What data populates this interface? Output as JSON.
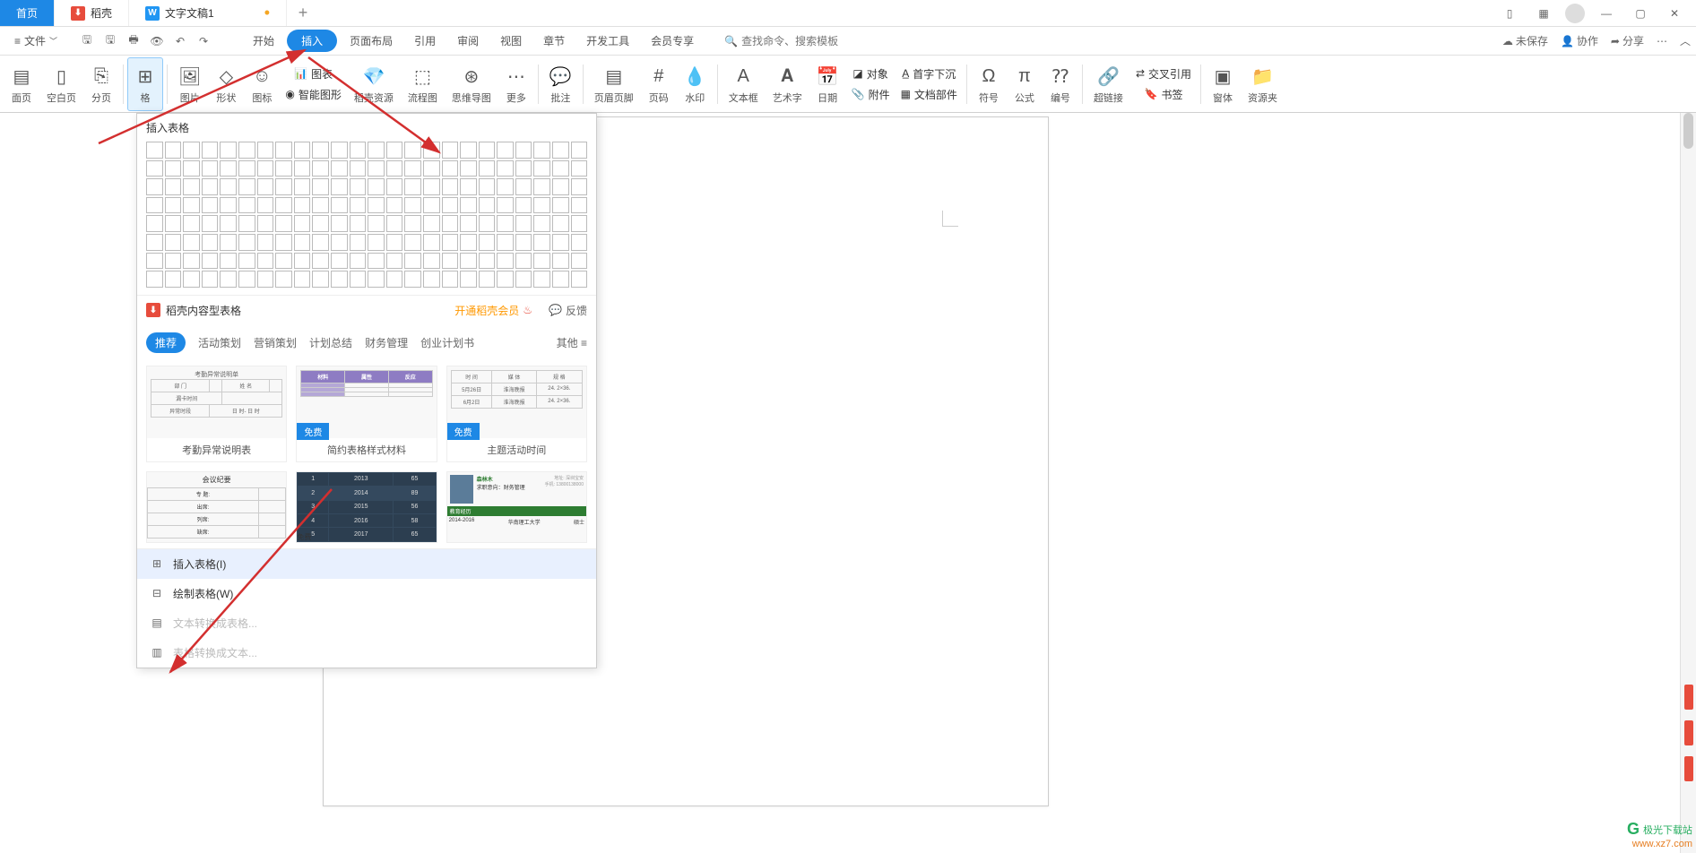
{
  "titlebar": {
    "home": "首页",
    "docer": "稻壳",
    "doc_title": "文字文稿1",
    "newtab_glyph": "+"
  },
  "menubar": {
    "file": "文件",
    "tabs": {
      "start": "开始",
      "insert": "插入",
      "page_layout": "页面布局",
      "reference": "引用",
      "review": "审阅",
      "view": "视图",
      "section": "章节",
      "dev_tools": "开发工具",
      "member": "会员专享"
    },
    "search_placeholder": "查找命令、搜索模板",
    "right": {
      "unsaved": "未保存",
      "coop": "协作",
      "share": "分享"
    }
  },
  "ribbon": {
    "cover": "面页",
    "blank_page": "空白页",
    "page_break": "分页",
    "table": "格",
    "picture": "图片",
    "shape": "形状",
    "icon": "图标",
    "chart": "图表",
    "smart_shape": "智能图形",
    "docer_res": "稻壳资源",
    "flowchart": "流程图",
    "mindmap": "思维导图",
    "more": "更多",
    "comment": "批注",
    "header_footer": "页眉页脚",
    "page_number": "页码",
    "watermark": "水印",
    "textbox": "文本框",
    "wordart": "艺术字",
    "date": "日期",
    "object": "对象",
    "attachment": "附件",
    "doc_parts": "文档部件",
    "drop_cap": "首字下沉",
    "symbol": "符号",
    "equation": "公式",
    "number": "编号",
    "hyperlink": "超链接",
    "cross_ref": "交叉引用",
    "bookmark": "书签",
    "window": "窗体",
    "resource_folder": "资源夹"
  },
  "dropdown": {
    "title": "插入表格",
    "docer_section": "稻壳内容型表格",
    "vip": "开通稻壳会员",
    "feedback": "反馈",
    "tags": {
      "recommend": "推荐",
      "event_plan": "活动策划",
      "marketing": "营销策划",
      "plan_summary": "计划总结",
      "finance": "财务管理",
      "biz_plan": "创业计划书",
      "other": "其他"
    },
    "free_badge": "免费",
    "templates": {
      "t1": "考勤异常说明表",
      "t2": "简约表格样式材料",
      "t3": "主题活动时间"
    },
    "preview_t2": {
      "c1": "材料",
      "c2": "属性",
      "c3": "反应"
    },
    "preview_t3": {
      "h1": "时 间",
      "h2": "媒 体",
      "h3": "规 格",
      "r1c1": "5月26日",
      "r1c2": "淮海晚报",
      "r1c3": "24. 2×36.",
      "r2c1": "6月2日",
      "r2c2": "淮海晚报",
      "r2c3": "24. 2×36."
    },
    "options": {
      "insert_table": "插入表格(I)",
      "draw_table": "绘制表格(W)",
      "text_to_table": "文本转换成表格...",
      "table_to_text": "表格转换成文本..."
    }
  },
  "watermark": {
    "brand": "极光下载站",
    "url": "www.xz7.com"
  }
}
